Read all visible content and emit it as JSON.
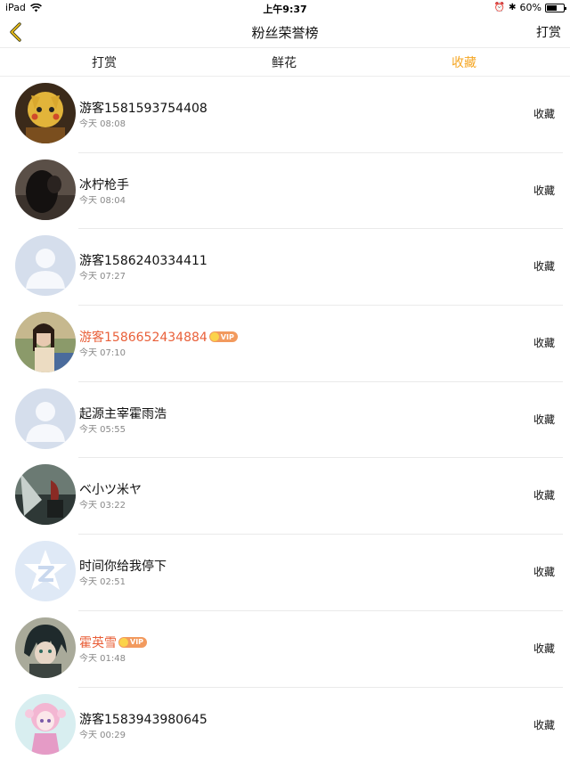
{
  "status_bar": {
    "device": "iPad",
    "time": "上午9:37",
    "battery_text": "60%",
    "battery_level": 0.6
  },
  "nav": {
    "title": "粉丝荣誉榜",
    "right_label": "打赏"
  },
  "tabs": [
    {
      "label": "打赏",
      "active": false
    },
    {
      "label": "鲜花",
      "active": false
    },
    {
      "label": "收藏",
      "active": true
    }
  ],
  "colors": {
    "accent": "#f5a623",
    "vip_name": "#e9603a",
    "vip_badge": "#f29a5e"
  },
  "vip_badge_text": "VIP",
  "fans": [
    {
      "name": "游客1581593754408",
      "time": "今天 08:08",
      "action": "收藏",
      "vip": false,
      "avatar": "cartoon-character"
    },
    {
      "name": "冰柠枪手",
      "time": "今天 08:04",
      "action": "收藏",
      "vip": false,
      "avatar": "dark-photo"
    },
    {
      "name": "游客1586240334411",
      "time": "今天 07:27",
      "action": "收藏",
      "vip": false,
      "avatar": "default-person"
    },
    {
      "name": "游客1586652434884",
      "time": "今天 07:10",
      "action": "收藏",
      "vip": true,
      "avatar": "girl-photo"
    },
    {
      "name": "起源主宰霍雨浩",
      "time": "今天 05:55",
      "action": "收藏",
      "vip": false,
      "avatar": "default-person"
    },
    {
      "name": "ベ小ツ米ヤ",
      "time": "今天 03:22",
      "action": "收藏",
      "vip": false,
      "avatar": "scenery-photo"
    },
    {
      "name": "时间你给我停下",
      "time": "今天 02:51",
      "action": "收藏",
      "vip": false,
      "avatar": "qzone-star"
    },
    {
      "name": "霍英雪",
      "time": "今天 01:48",
      "action": "收藏",
      "vip": true,
      "avatar": "anime-character"
    },
    {
      "name": "游客1583943980645",
      "time": "今天 00:29",
      "action": "收藏",
      "vip": false,
      "avatar": "pink-anime"
    }
  ]
}
